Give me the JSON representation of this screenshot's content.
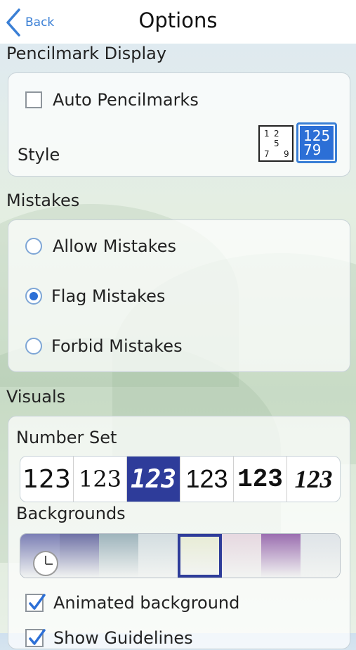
{
  "header": {
    "back_label": "Back",
    "title": "Options"
  },
  "pencilmark": {
    "heading": "Pencilmark Display",
    "auto_label": "Auto Pencilmarks",
    "auto_checked": false,
    "style_label": "Style",
    "style_a_digits": [
      "1",
      "2",
      "5",
      "7",
      "9"
    ],
    "style_b_lines": [
      "125",
      "79"
    ]
  },
  "mistakes": {
    "heading": "Mistakes",
    "options": [
      {
        "label": "Allow Mistakes",
        "selected": false
      },
      {
        "label": "Flag Mistakes",
        "selected": true
      },
      {
        "label": "Forbid Mistakes",
        "selected": false
      }
    ]
  },
  "visuals": {
    "heading": "Visuals",
    "number_set_label": "Number Set",
    "number_sets": [
      "123",
      "123",
      "123",
      "123",
      "123",
      "123"
    ],
    "number_set_selected": 2,
    "backgrounds_label": "Backgrounds",
    "background_colors": [
      "#7b7fb5",
      "#6f72a6",
      "#9eb4bc",
      "#d3dde0",
      "#e8ecd6",
      "#e6d8e0",
      "#9b6eb0",
      "#dfe4e8"
    ],
    "background_selected": 4,
    "animated_label": "Animated background",
    "animated_checked": true,
    "next_label": "Show Guidelines"
  },
  "colors": {
    "accent": "#2c6fd6",
    "selected_set": "#2e3c9a"
  }
}
